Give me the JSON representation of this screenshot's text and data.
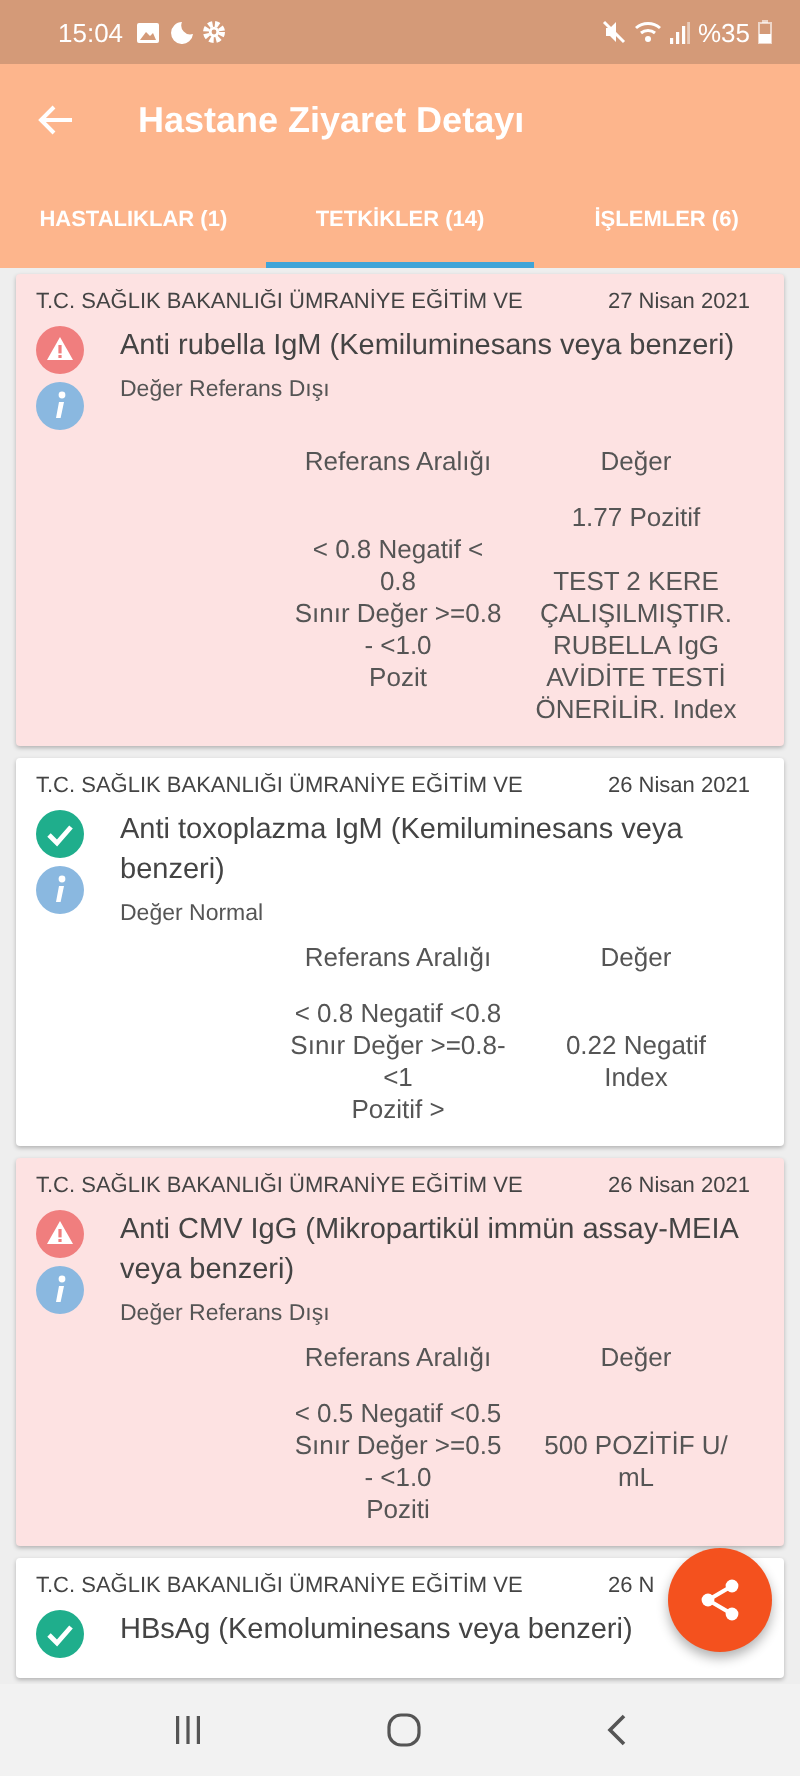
{
  "status_bar": {
    "time": "15:04",
    "battery": "%35"
  },
  "app_bar": {
    "title": "Hastane Ziyaret Detayı"
  },
  "tabs": [
    {
      "label": "HASTALIKLAR (1)",
      "selected": false
    },
    {
      "label": "TETKİKLER (14)",
      "selected": true
    },
    {
      "label": "İŞLEMLER (6)",
      "selected": false
    }
  ],
  "results": [
    {
      "kind": "abnormal",
      "hospital": "T.C. SAĞLIK BAKANLIĞI ÜMRANİYE EĞİTİM VE",
      "date": "27 Nisan 2021",
      "test": "Anti rubella IgM (Kemiluminesans veya benzeri)",
      "note": "Değer Referans Dışı",
      "ref_header": "Referans Aralığı",
      "value_header": "Değer",
      "reference": [
        "< 0.8 Negatif <",
        "0.8",
        "Sınır Değer >=0.8",
        "- <1.0",
        "Pozit"
      ],
      "value": [
        [
          "1.77 Pozitif"
        ],
        [
          "TEST 2 KERE",
          "ÇALIŞILMIŞTIR.",
          "RUBELLA IgG",
          "AVİDİTE TESTİ",
          "ÖNERİLİR. Index"
        ]
      ]
    },
    {
      "kind": "normal",
      "hospital": "T.C. SAĞLIK BAKANLIĞI ÜMRANİYE EĞİTİM VE",
      "date": "26 Nisan 2021",
      "test": "Anti toxoplazma IgM (Kemiluminesans veya benzeri)",
      "note": "Değer Normal",
      "ref_header": "Referans Aralığı",
      "value_header": "Değer",
      "reference": [
        "< 0.8 Negatif <0.8",
        "Sınır Değer >=0.8-",
        "<1",
        "Pozitif >"
      ],
      "value": [
        [
          "0.22 Negatif",
          "Index"
        ]
      ]
    },
    {
      "kind": "abnormal",
      "hospital": "T.C. SAĞLIK BAKANLIĞI ÜMRANİYE EĞİTİM VE",
      "date": "26 Nisan 2021",
      "test": "Anti CMV IgG (Mikropartikül immün assay-MEIA veya benzeri)",
      "note": "Değer Referans Dışı",
      "ref_header": "Referans Aralığı",
      "value_header": "Değer",
      "reference": [
        "< 0.5 Negatif <0.5",
        "Sınır Değer >=0.5",
        "- <1.0",
        "Poziti"
      ],
      "value": [
        [
          "500 POZİTİF U/",
          "mL"
        ]
      ]
    },
    {
      "kind": "normal",
      "hospital": "T.C. SAĞLIK BAKANLIĞI ÜMRANİYE EĞİTİM VE",
      "date": "26 N",
      "test": "HBsAg (Kemoluminesans veya benzeri)"
    }
  ]
}
